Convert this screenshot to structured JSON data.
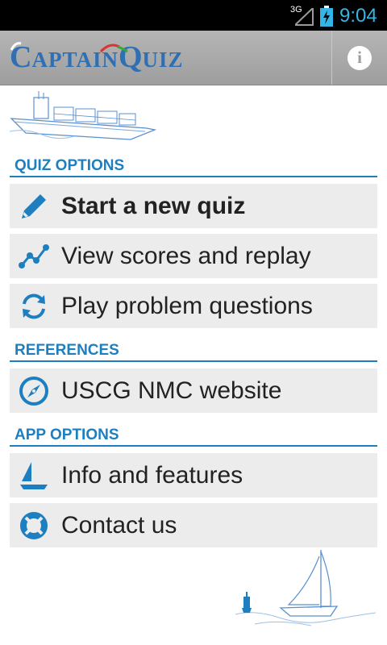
{
  "statusbar": {
    "network": "3G",
    "time": "9:04"
  },
  "header": {
    "title_first": "C",
    "title_rest1": "APTAIN",
    "title_q": "Q",
    "title_rest2": "UIZ",
    "info_icon": "info-icon"
  },
  "sections": [
    {
      "title": "QUIZ OPTIONS"
    },
    {
      "title": "REFERENCES"
    },
    {
      "title": "APP OPTIONS"
    }
  ],
  "items": [
    {
      "label": "Start a new quiz",
      "icon": "pencil-icon"
    },
    {
      "label": "View scores and replay",
      "icon": "chart-line-icon"
    },
    {
      "label": "Play problem questions",
      "icon": "refresh-icon"
    },
    {
      "label": "USCG NMC website",
      "icon": "compass-icon"
    },
    {
      "label": "Info and features",
      "icon": "sailboat-icon"
    },
    {
      "label": "Contact us",
      "icon": "lifebuoy-icon"
    }
  ],
  "colors": {
    "accent": "#1e7fc0",
    "statusbar_text": "#33b5e5",
    "item_bg": "#ececec"
  }
}
